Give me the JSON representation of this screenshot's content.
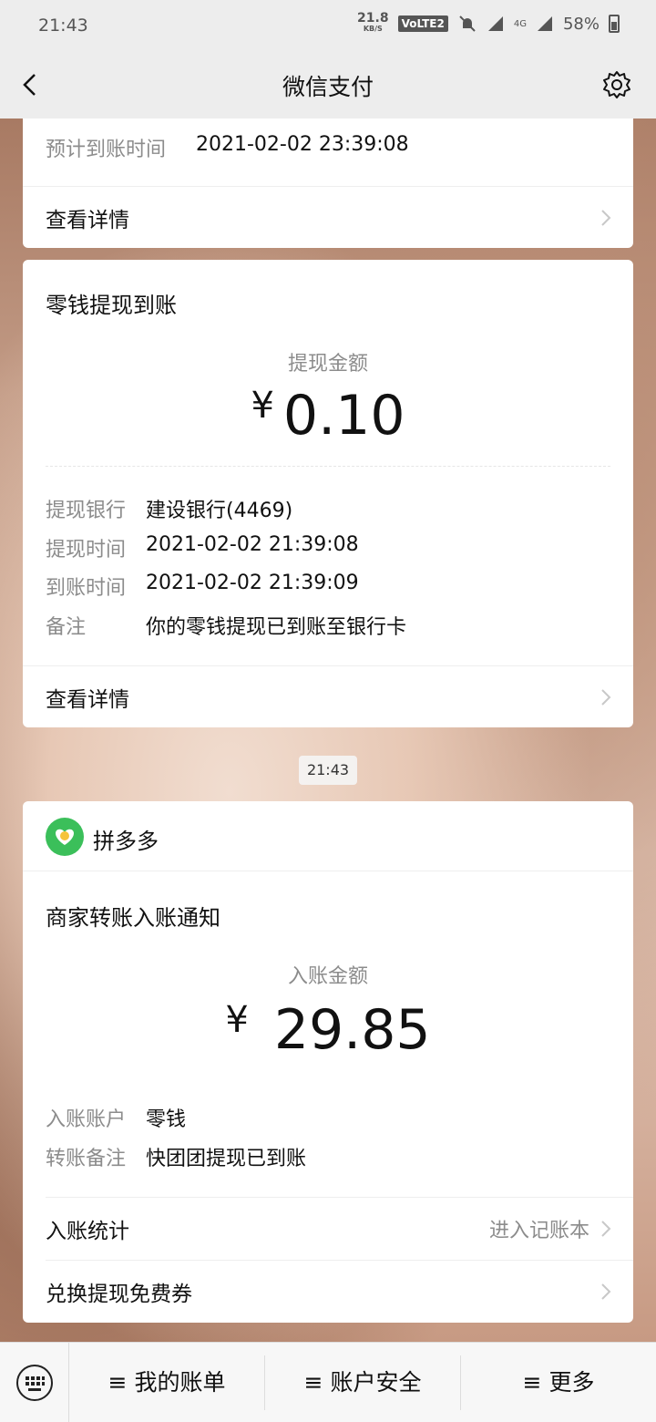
{
  "status": {
    "time": "21:43",
    "speed_value": "21.8",
    "speed_unit": "KB/S",
    "volte": "VoLTE2",
    "network": "4G",
    "battery": "58%"
  },
  "header": {
    "title": "微信支付"
  },
  "card1": {
    "expected_label": "预计到账时间",
    "expected_value": "2021-02-02 23:39:08",
    "detail_label": "查看详情"
  },
  "card2": {
    "title": "零钱提现到账",
    "amount_label": "提现金额",
    "currency": "¥",
    "amount": "0.10",
    "rows": [
      {
        "k": "提现银行",
        "v": "建设银行(4469)"
      },
      {
        "k": "提现时间",
        "v": "2021-02-02 21:39:08"
      },
      {
        "k": "到账时间",
        "v": "2021-02-02 21:39:09"
      },
      {
        "k": "备注",
        "v": "你的零钱提现已到账至银行卡"
      }
    ],
    "detail_label": "查看详情"
  },
  "timestamp": "21:43",
  "card3": {
    "merchant": "拼多多",
    "title": "商家转账入账通知",
    "amount_label": "入账金额",
    "currency": "¥",
    "amount": "29.85",
    "rows": [
      {
        "k": "入账账户",
        "v": "零钱"
      },
      {
        "k": "转账备注",
        "v": "快团团提现已到账"
      }
    ],
    "stats_label": "入账统计",
    "stats_link": "进入记账本",
    "coupon_label": "兑换提现免费券"
  },
  "bottom": {
    "menus": [
      "≡ 我的账单",
      "≡ 账户安全",
      "≡ 更多"
    ]
  },
  "colors": {
    "accent_green": "#3bbf5a",
    "bg_gray": "#ededed"
  }
}
